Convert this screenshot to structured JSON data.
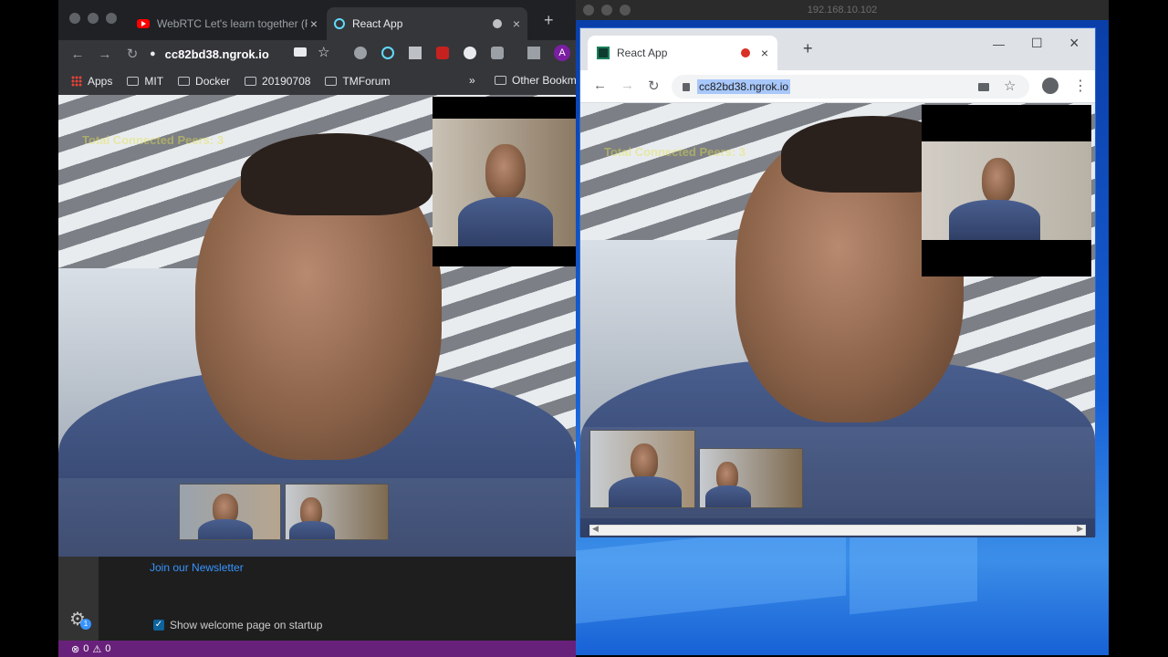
{
  "left_window": {
    "tabs": [
      {
        "label": "WebRTC Let's learn together (R"
      },
      {
        "label": "React App"
      }
    ],
    "url": "cc82bd38.ngrok.io",
    "profile_initial": "A",
    "bookmarks": [
      "Apps",
      "MIT",
      "Docker",
      "20190708",
      "TMForum"
    ],
    "bookmarks_overflow": "»",
    "other_bookmarks": "Other Bookm",
    "video_overlay_text": "Total Connected Peers: 3",
    "newsletter_link": "Join our Newsletter",
    "welcome_checkbox_label": "Show welcome page on startup",
    "status_errors": "0",
    "status_warnings": "0",
    "notification_count": "1"
  },
  "right_window": {
    "vm_title": "192.168.10.102",
    "tab_label": "React App",
    "new_tab": "+",
    "url": "cc82bd38.ngrok.io",
    "video_overlay_text": "Total Connected Peers: 3"
  },
  "icons": {
    "close": "×",
    "plus": "+",
    "back": "←",
    "forward": "→",
    "reload": "↻",
    "star": "☆",
    "lock": "🔒",
    "menu": "⋮",
    "minimize": "—",
    "maximize": "☐"
  },
  "colors": {
    "overlay_text": "#e4e14a",
    "status_bar": "#68217a",
    "link": "#3794ff",
    "desktop": "#1761d6"
  }
}
